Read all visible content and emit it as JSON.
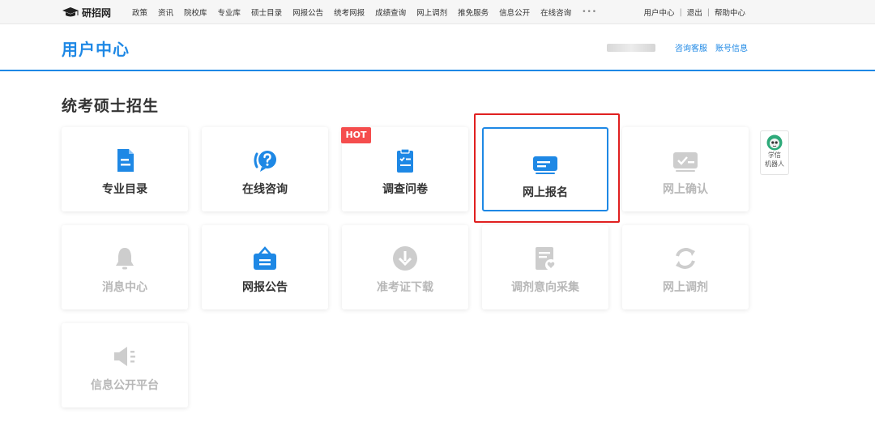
{
  "topnav": {
    "logo_text": "研招网",
    "links": [
      "政策",
      "资讯",
      "院校库",
      "专业库",
      "硕士目录",
      "网报公告",
      "统考网报",
      "成绩查询",
      "网上调剂",
      "推免服务",
      "信息公开",
      "在线咨询"
    ],
    "more": "•••",
    "right": [
      "用户中心",
      "退出",
      "帮助中心"
    ],
    "separator": "|"
  },
  "header": {
    "title": "用户中心",
    "links": [
      "咨询客服",
      "账号信息"
    ]
  },
  "section": {
    "title": "统考硕士招生"
  },
  "cards": [
    {
      "label": "专业目录",
      "icon": "document-icon",
      "enabled": true
    },
    {
      "label": "在线咨询",
      "icon": "question-bubble-icon",
      "enabled": true
    },
    {
      "label": "调查问卷",
      "icon": "clipboard-icon",
      "enabled": true,
      "badge": "HOT"
    },
    {
      "label": "网上报名",
      "icon": "id-card-icon",
      "enabled": true,
      "selected": true
    },
    {
      "label": "网上确认",
      "icon": "confirm-card-icon",
      "enabled": false
    },
    {
      "label": "消息中心",
      "icon": "bell-icon",
      "enabled": false
    },
    {
      "label": "网报公告",
      "icon": "notice-board-icon",
      "enabled": true
    },
    {
      "label": "准考证下载",
      "icon": "download-icon",
      "enabled": false
    },
    {
      "label": "调剂意向采集",
      "icon": "form-heart-icon",
      "enabled": false
    },
    {
      "label": "网上调剂",
      "icon": "refresh-icon",
      "enabled": false
    },
    {
      "label": "信息公开平台",
      "icon": "megaphone-icon",
      "enabled": false
    }
  ],
  "robot": {
    "line1": "学信",
    "line2": "机器人"
  },
  "colors": {
    "accent": "#1e88e5",
    "hot_badge": "#f54d4d",
    "highlight_box": "#e02020",
    "disabled": "#b8b8b8"
  }
}
